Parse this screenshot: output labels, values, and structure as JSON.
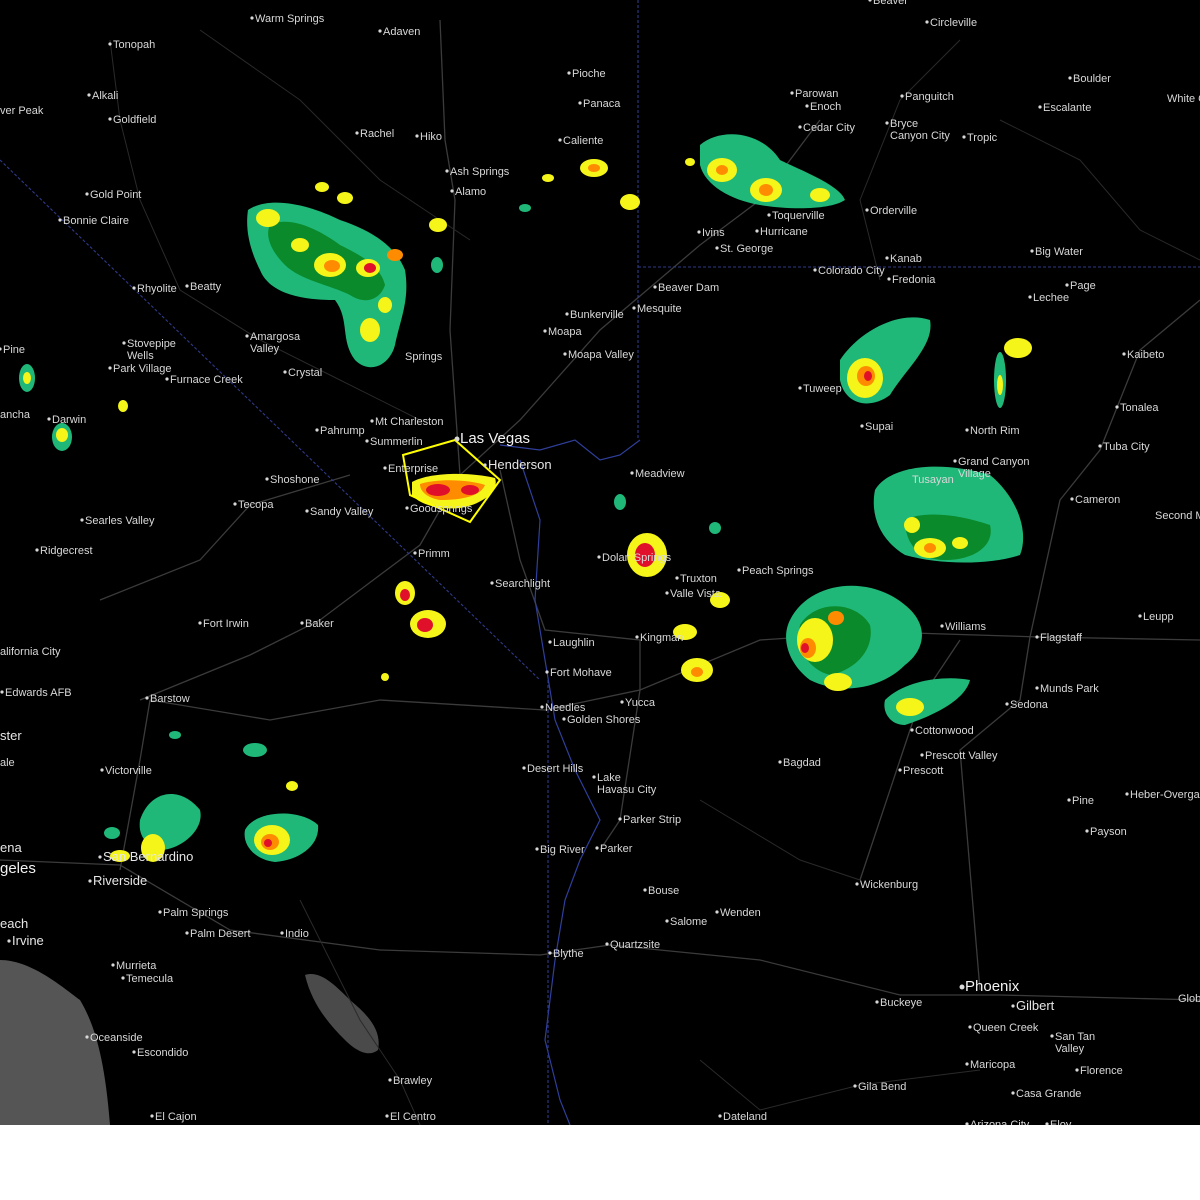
{
  "map": {
    "colors": {
      "background": "#000000",
      "land_label": "#d8d8d8",
      "ocean": "#555555",
      "state_border": "#2f3a8a",
      "warning_polygon": "#ffff00",
      "radar_light": "#1fb879",
      "radar_green": "#0a8a2a",
      "radar_yellow": "#f5f51a",
      "radar_orange": "#ff8c00",
      "radar_red": "#e0102a"
    },
    "places": [
      {
        "name": "Warm Springs",
        "size": "small"
      },
      {
        "name": "Adaven",
        "size": "small"
      },
      {
        "name": "Tonopah",
        "size": "small"
      },
      {
        "name": "Pioche",
        "size": "small"
      },
      {
        "name": "Panaca",
        "size": "small"
      },
      {
        "name": "Alkali",
        "size": "small"
      },
      {
        "name": "ver Peak",
        "size": "small"
      },
      {
        "name": "Goldfield",
        "size": "small"
      },
      {
        "name": "Rachel",
        "size": "small"
      },
      {
        "name": "Hiko",
        "size": "small"
      },
      {
        "name": "Caliente",
        "size": "small"
      },
      {
        "name": "Ash Springs",
        "size": "small"
      },
      {
        "name": "Alamo",
        "size": "small"
      },
      {
        "name": "Gold Point",
        "size": "small"
      },
      {
        "name": "Bonnie Claire",
        "size": "small"
      },
      {
        "name": "Rhyolite",
        "size": "small"
      },
      {
        "name": "Beatty",
        "size": "small"
      },
      {
        "name": "Amargosa Valley",
        "size": "small"
      },
      {
        "name": "Stovepipe Wells",
        "size": "small"
      },
      {
        "name": "Park Village",
        "size": "small"
      },
      {
        "name": "Furnace Creek",
        "size": "small"
      },
      {
        "name": "Crystal",
        "size": "small"
      },
      {
        "name": "Springs",
        "size": "small"
      },
      {
        "name": "Pine",
        "size": "small"
      },
      {
        "name": "Darwin",
        "size": "small"
      },
      {
        "name": "ancha",
        "size": "small"
      },
      {
        "name": "Mt Charleston",
        "size": "small"
      },
      {
        "name": "Pahrump",
        "size": "small"
      },
      {
        "name": "Summerlin",
        "size": "small"
      },
      {
        "name": "Las Vegas",
        "size": "big"
      },
      {
        "name": "Henderson",
        "size": "medium"
      },
      {
        "name": "Enterprise",
        "size": "small"
      },
      {
        "name": "Shoshone",
        "size": "small"
      },
      {
        "name": "Tecopa",
        "size": "small"
      },
      {
        "name": "Sandy Valley",
        "size": "small"
      },
      {
        "name": "Goodsprings",
        "size": "small"
      },
      {
        "name": "Searles Valley",
        "size": "small"
      },
      {
        "name": "Ridgecrest",
        "size": "small"
      },
      {
        "name": "Primm",
        "size": "small"
      },
      {
        "name": "Searchlight",
        "size": "small"
      },
      {
        "name": "Fort Irwin",
        "size": "small"
      },
      {
        "name": "Baker",
        "size": "small"
      },
      {
        "name": "alifornia City",
        "size": "small"
      },
      {
        "name": "Edwards AFB",
        "size": "small"
      },
      {
        "name": "Barstow",
        "size": "small"
      },
      {
        "name": "ster",
        "size": "medium"
      },
      {
        "name": "ale",
        "size": "small"
      },
      {
        "name": "Victorville",
        "size": "small"
      },
      {
        "name": "San Bernardino",
        "size": "medium"
      },
      {
        "name": "Riverside",
        "size": "medium"
      },
      {
        "name": "ena",
        "size": "medium"
      },
      {
        "name": "geles",
        "size": "big"
      },
      {
        "name": "each",
        "size": "medium"
      },
      {
        "name": "Irvine",
        "size": "medium"
      },
      {
        "name": "Palm Springs",
        "size": "small"
      },
      {
        "name": "Palm Desert",
        "size": "small"
      },
      {
        "name": "Indio",
        "size": "small"
      },
      {
        "name": "Murrieta",
        "size": "small"
      },
      {
        "name": "Temecula",
        "size": "small"
      },
      {
        "name": "Oceanside",
        "size": "small"
      },
      {
        "name": "Escondido",
        "size": "small"
      },
      {
        "name": "Brawley",
        "size": "small"
      },
      {
        "name": "El Cajon",
        "size": "small"
      },
      {
        "name": "El Centro",
        "size": "small"
      },
      {
        "name": "Laughlin",
        "size": "small"
      },
      {
        "name": "Fort Mohave",
        "size": "small"
      },
      {
        "name": "Needles",
        "size": "small"
      },
      {
        "name": "Golden Shores",
        "size": "small"
      },
      {
        "name": "Desert Hills",
        "size": "small"
      },
      {
        "name": "Lake Havasu City",
        "size": "small"
      },
      {
        "name": "Parker Strip",
        "size": "small"
      },
      {
        "name": "Big River",
        "size": "small"
      },
      {
        "name": "Parker",
        "size": "small"
      },
      {
        "name": "Blythe",
        "size": "small"
      },
      {
        "name": "Quartzsite",
        "size": "small"
      },
      {
        "name": "Bouse",
        "size": "small"
      },
      {
        "name": "Salome",
        "size": "small"
      },
      {
        "name": "Wenden",
        "size": "small"
      },
      {
        "name": "Dateland",
        "size": "small"
      },
      {
        "name": "Yucca",
        "size": "small"
      },
      {
        "name": "Kingman",
        "size": "small"
      },
      {
        "name": "Dolan Springs",
        "size": "small"
      },
      {
        "name": "Meadview",
        "size": "small"
      },
      {
        "name": "Truxton",
        "size": "small"
      },
      {
        "name": "Peach Springs",
        "size": "small"
      },
      {
        "name": "Valle Vista",
        "size": "small"
      },
      {
        "name": "Bagdad",
        "size": "small"
      },
      {
        "name": "Wickenburg",
        "size": "small"
      },
      {
        "name": "Buckeye",
        "size": "small"
      },
      {
        "name": "Phoenix",
        "size": "big"
      },
      {
        "name": "Gilbert",
        "size": "medium"
      },
      {
        "name": "Queen Creek",
        "size": "small"
      },
      {
        "name": "San Tan Valley",
        "size": "small"
      },
      {
        "name": "Maricopa",
        "size": "small"
      },
      {
        "name": "Florence",
        "size": "small"
      },
      {
        "name": "Casa Grande",
        "size": "small"
      },
      {
        "name": "Gila Bend",
        "size": "small"
      },
      {
        "name": "Arizona City",
        "size": "small"
      },
      {
        "name": "Eloy",
        "size": "small"
      },
      {
        "name": "Glob",
        "size": "small"
      },
      {
        "name": "Payson",
        "size": "small"
      },
      {
        "name": "Pine",
        "size": "small"
      },
      {
        "name": "Heber-Overgaard",
        "size": "small"
      },
      {
        "name": "Prescott",
        "size": "small"
      },
      {
        "name": "Prescott Valley",
        "size": "small"
      },
      {
        "name": "Cottonwood",
        "size": "small"
      },
      {
        "name": "Sedona",
        "size": "small"
      },
      {
        "name": "Munds Park",
        "size": "small"
      },
      {
        "name": "Flagstaff",
        "size": "small"
      },
      {
        "name": "Williams",
        "size": "small"
      },
      {
        "name": "Leupp",
        "size": "small"
      },
      {
        "name": "Second M",
        "size": "small"
      },
      {
        "name": "Cameron",
        "size": "small"
      },
      {
        "name": "Tuba City",
        "size": "small"
      },
      {
        "name": "Tonalea",
        "size": "small"
      },
      {
        "name": "Kaibeto",
        "size": "small"
      },
      {
        "name": "North Rim",
        "size": "small"
      },
      {
        "name": "Grand Canyon Village",
        "size": "small"
      },
      {
        "name": "Tusayan",
        "size": "small"
      },
      {
        "name": "Supai",
        "size": "small"
      },
      {
        "name": "Tuweep",
        "size": "small"
      },
      {
        "name": "Lechee",
        "size": "small"
      },
      {
        "name": "Page",
        "size": "small"
      },
      {
        "name": "Big Water",
        "size": "small"
      },
      {
        "name": "Kanab",
        "size": "small"
      },
      {
        "name": "Fredonia",
        "size": "small"
      },
      {
        "name": "Colorado City",
        "size": "small"
      },
      {
        "name": "Orderville",
        "size": "small"
      },
      {
        "name": "Hurricane",
        "size": "small"
      },
      {
        "name": "Toquerville",
        "size": "small"
      },
      {
        "name": "Ivins",
        "size": "small"
      },
      {
        "name": "St. George",
        "size": "small"
      },
      {
        "name": "Beaver Dam",
        "size": "small"
      },
      {
        "name": "Mesquite",
        "size": "small"
      },
      {
        "name": "Bunkerville",
        "size": "small"
      },
      {
        "name": "Moapa",
        "size": "small"
      },
      {
        "name": "Moapa Valley",
        "size": "small"
      },
      {
        "name": "Parowan",
        "size": "small"
      },
      {
        "name": "Enoch",
        "size": "small"
      },
      {
        "name": "Cedar City",
        "size": "small"
      },
      {
        "name": "Panguitch",
        "size": "small"
      },
      {
        "name": "Bryce Canyon City",
        "size": "small"
      },
      {
        "name": "Tropic",
        "size": "small"
      },
      {
        "name": "Escalante",
        "size": "small"
      },
      {
        "name": "Boulder",
        "size": "small"
      },
      {
        "name": "White C",
        "size": "small"
      },
      {
        "name": "Circleville",
        "size": "small"
      },
      {
        "name": "Beaver",
        "size": "small"
      }
    ]
  }
}
